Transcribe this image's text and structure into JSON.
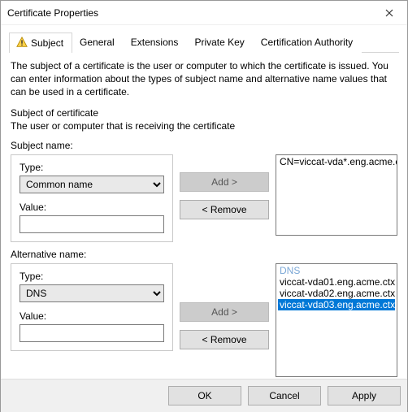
{
  "window": {
    "title": "Certificate Properties"
  },
  "tabs": {
    "subject": "Subject",
    "general": "General",
    "extensions": "Extensions",
    "private_key": "Private Key",
    "ca": "Certification Authority"
  },
  "subject_tab": {
    "description": "The subject of a certificate is the user or computer to which the certificate is issued. You can enter information about the types of subject name and alternative name values that can be used in a certificate.",
    "section_title": "Subject of certificate",
    "section_sub": "The user or computer that is receiving the certificate",
    "subject_name_label": "Subject name:",
    "alt_name_label": "Alternative name:",
    "type_label": "Type:",
    "value_label": "Value:",
    "subject_type_selected": "Common name",
    "subject_value": "",
    "alt_type_selected": "DNS",
    "alt_value": "",
    "add_label": "Add >",
    "remove_label": "< Remove",
    "subject_list": [
      "CN=viccat-vda*.eng.acme.ctx"
    ],
    "alt_list_header": "DNS",
    "alt_list": [
      {
        "text": "viccat-vda01.eng.acme.ctx",
        "selected": false
      },
      {
        "text": "viccat-vda02.eng.acme.ctx",
        "selected": false
      },
      {
        "text": "viccat-vda03.eng.acme.ctx",
        "selected": true
      }
    ]
  },
  "buttons": {
    "ok": "OK",
    "cancel": "Cancel",
    "apply": "Apply"
  }
}
